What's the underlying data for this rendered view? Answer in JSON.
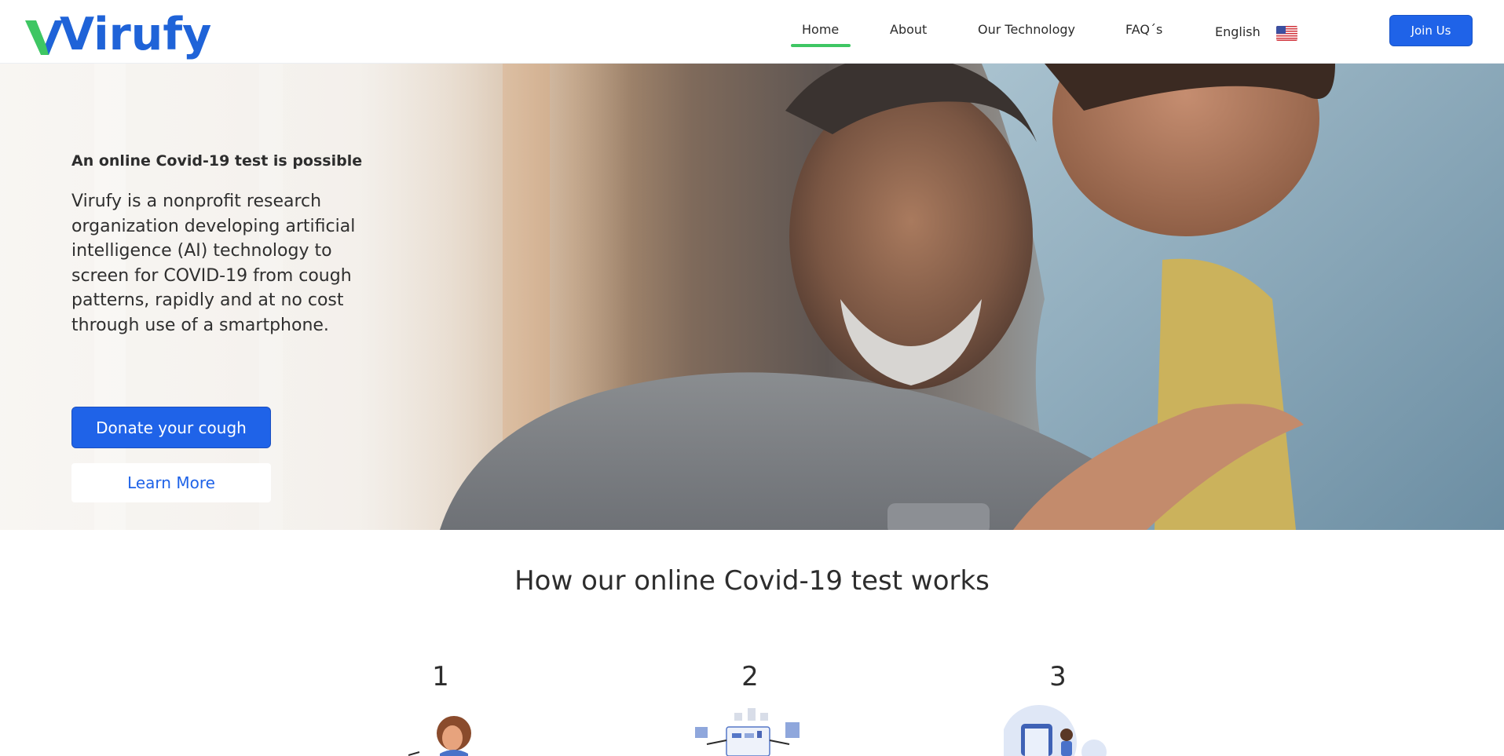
{
  "brand": {
    "name": "Virufy",
    "primary_color": "#1f63e8",
    "accent_color": "#3ec663"
  },
  "nav": {
    "items": [
      {
        "label": "Home",
        "active": true
      },
      {
        "label": "About"
      },
      {
        "label": "Our Technology"
      },
      {
        "label": "FAQ´s"
      }
    ],
    "language": {
      "label": "English",
      "flag_icon": "us-flag-icon"
    },
    "join_label": "Join Us"
  },
  "hero": {
    "title": "An online Covid-19 test is possible",
    "description": "Virufy is a nonprofit research organization developing artificial intelligence (AI) technology to screen for COVID-19 from cough patterns, rapidly and at no cost through use of a smartphone.",
    "donate_label": "Donate your cough",
    "learn_label": "Learn More"
  },
  "how": {
    "title": "How our online Covid-19 test works",
    "steps": [
      {
        "number": "1"
      },
      {
        "number": "2"
      },
      {
        "number": "3"
      }
    ]
  }
}
